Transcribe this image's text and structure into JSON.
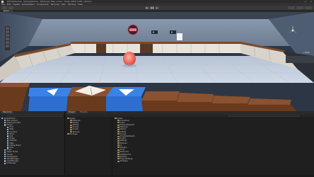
{
  "window": {
    "title": "KitchenScene - SampleScene - Windows, Mac, Linux - Unity 2022.3 LTS <DX11>",
    "menu": [
      "File",
      "Edit",
      "Assets",
      "GameObject",
      "Component",
      "Services",
      "Jobs",
      "Window",
      "Help"
    ]
  },
  "scene": {
    "tab_label": "Scene",
    "gizmo_label": "< Persp"
  },
  "hierarchy": {
    "tab_label": "Hierarchy",
    "items": [
      "SampleScene",
      "Main Camera",
      "Directional Light",
      "Kitchen",
      "Floor",
      "Walls",
      "Counters",
      "Stove",
      "Sink",
      "Fridge",
      "Cabinets",
      "Table",
      "Cutting Board",
      "Book",
      "Player",
      "Spawn Points",
      "Canvas",
      "EventSystem",
      "GameManager",
      "AudioManager",
      "UI Manager"
    ]
  },
  "project": {
    "tabs": [
      "Project",
      "Console"
    ],
    "folders": [
      "Assets",
      "Materials",
      "Models",
      "Prefabs",
      "Scenes",
      "Scripts",
      "Textures",
      "Packages"
    ],
    "assets": [
      "Assets",
      "Animations",
      "Audio",
      "KitchenObjectSO",
      "Materials",
      "Meshes",
      "Prefabs",
      "Scenes",
      "ScriptableObjects",
      "Scripts",
      "Settings",
      "Textures",
      "UI",
      "Shaders",
      "Fonts",
      "Resources",
      "TextMesh Pro",
      "Readme",
      "ProjectSettings",
      "Packages"
    ]
  }
}
